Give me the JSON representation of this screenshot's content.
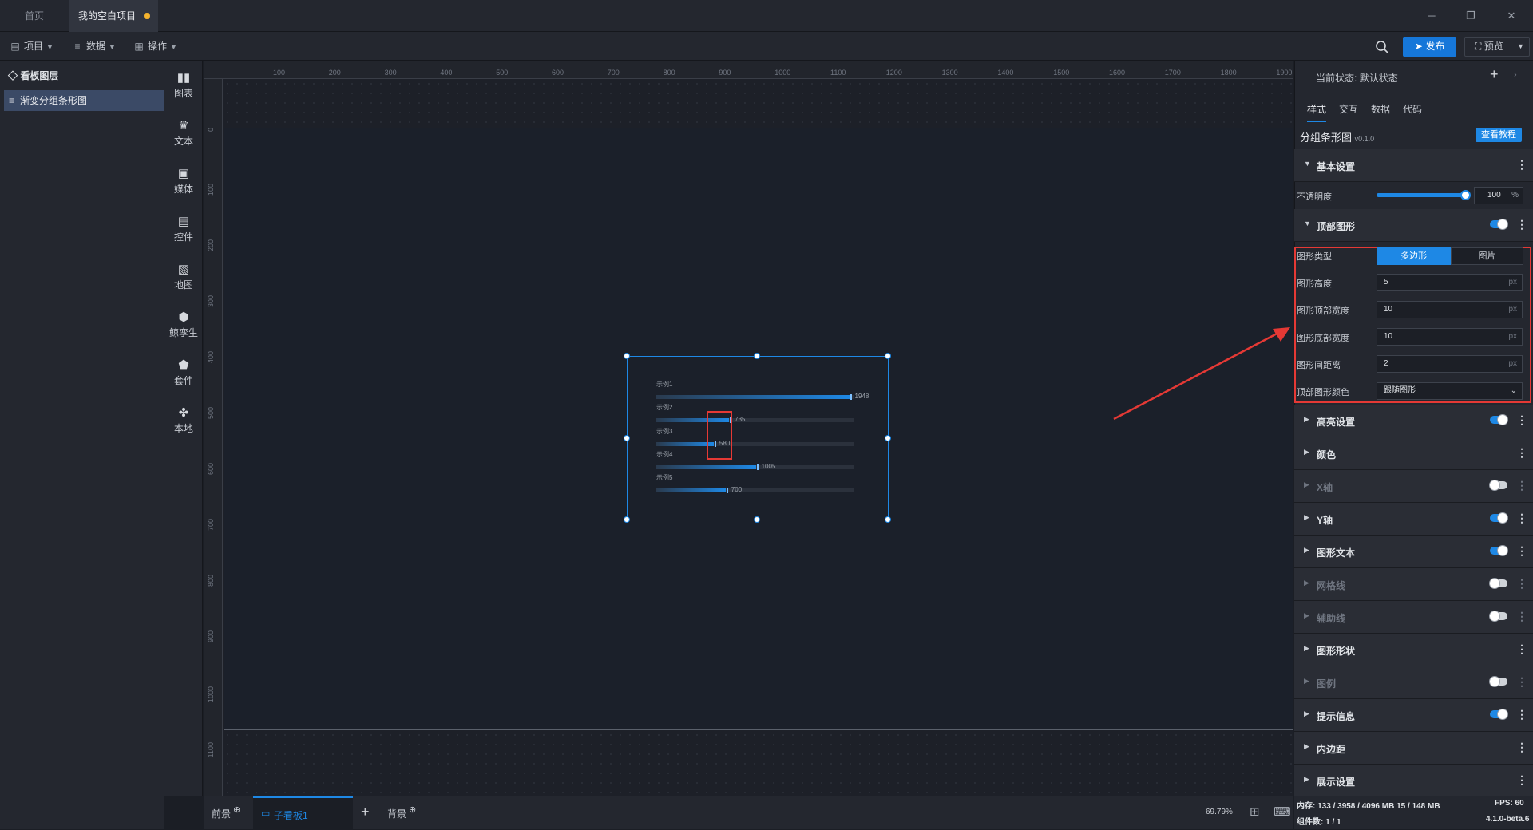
{
  "tabs": {
    "home": "首页",
    "project": "我的空白项目"
  },
  "menu": {
    "project": "项目",
    "data": "数据",
    "operate": "操作",
    "publish": "发布",
    "preview": "预览"
  },
  "layers": {
    "title": "看板图层",
    "item": "渐变分组条形图"
  },
  "tools": [
    "图表",
    "文本",
    "媒体",
    "控件",
    "地图",
    "鲸孪生",
    "套件",
    "本地"
  ],
  "ruler": {
    "top": [
      "100",
      "200",
      "300",
      "400",
      "500",
      "600",
      "700",
      "800",
      "900",
      "1000",
      "1100",
      "1200",
      "1300",
      "1400",
      "1500",
      "1600",
      "1700",
      "1800",
      "1900"
    ],
    "left": [
      "0",
      "100",
      "200",
      "300",
      "400",
      "500",
      "600",
      "700",
      "800",
      "900",
      "1000",
      "1100"
    ]
  },
  "chart_data": {
    "type": "bar",
    "categories": [
      "示例1",
      "示例2",
      "示例3",
      "示例4",
      "示例5"
    ],
    "values": [
      1948,
      735,
      580,
      1005,
      700
    ],
    "max": 2000
  },
  "bottom": {
    "foreground": "前景",
    "subboard": "子看板1",
    "background": "背景",
    "zoom": "69.79%"
  },
  "panel": {
    "state_label": "当前状态:",
    "state_value": "默认状态",
    "tabs": [
      "样式",
      "交互",
      "数据",
      "代码"
    ],
    "component": "分组条形图",
    "version": "v0.1.0",
    "tutorial": "查看教程",
    "basic": "基本设置",
    "opacity_label": "不透明度",
    "opacity_value": "100",
    "opacity_unit": "%",
    "opacity_fraction": 1.0,
    "top_shape": "顶部图形",
    "shape_type_label": "图形类型",
    "shape_type_options": [
      "多边形",
      "图片"
    ],
    "height_label": "图形高度",
    "height_value": "5",
    "top_width_label": "图形顶部宽度",
    "top_width_value": "10",
    "bottom_width_label": "图形底部宽度",
    "bottom_width_value": "10",
    "spacing_label": "图形间距离",
    "spacing_value": "2",
    "color_label": "顶部图形颜色",
    "color_value": "跟随图形",
    "unit": "px",
    "sections": [
      {
        "label": "高亮设置",
        "toggle": "on"
      },
      {
        "label": "颜色",
        "toggle": "none"
      },
      {
        "label": "X轴",
        "toggle": "off"
      },
      {
        "label": "Y轴",
        "toggle": "on"
      },
      {
        "label": "图形文本",
        "toggle": "on"
      },
      {
        "label": "网格线",
        "toggle": "off"
      },
      {
        "label": "辅助线",
        "toggle": "off"
      },
      {
        "label": "图形形状",
        "toggle": "none"
      },
      {
        "label": "图例",
        "toggle": "off"
      },
      {
        "label": "提示信息",
        "toggle": "on"
      },
      {
        "label": "内边距",
        "toggle": "none"
      },
      {
        "label": "展示设置",
        "toggle": "none"
      }
    ],
    "memory": "内存: 133 / 3958 / 4096 MB 15 / 148 MB",
    "fps": "FPS: 60",
    "components": "组件数: 1 / 1",
    "build": "4.1.0-beta.6"
  },
  "colors": {
    "accent": "#1e88e5",
    "highlight": "#e53935",
    "selected_layer": "#3b4a66"
  }
}
